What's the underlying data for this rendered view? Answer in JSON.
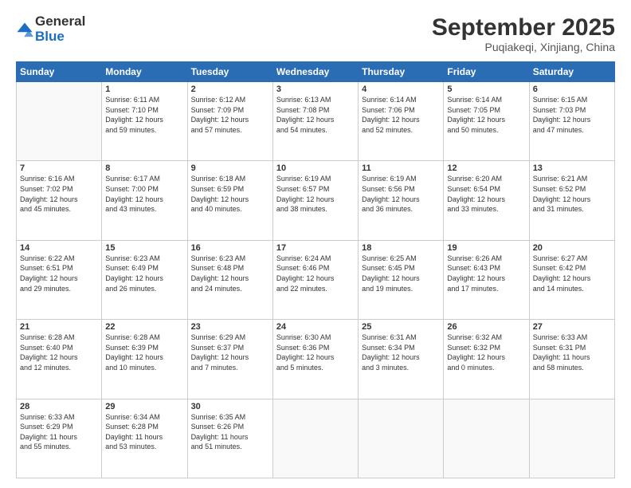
{
  "logo": {
    "general": "General",
    "blue": "Blue"
  },
  "header": {
    "month": "September 2025",
    "location": "Puqiakeqi, Xinjiang, China"
  },
  "weekdays": [
    "Sunday",
    "Monday",
    "Tuesday",
    "Wednesday",
    "Thursday",
    "Friday",
    "Saturday"
  ],
  "weeks": [
    [
      {
        "day": "",
        "info": ""
      },
      {
        "day": "1",
        "info": "Sunrise: 6:11 AM\nSunset: 7:10 PM\nDaylight: 12 hours\nand 59 minutes."
      },
      {
        "day": "2",
        "info": "Sunrise: 6:12 AM\nSunset: 7:09 PM\nDaylight: 12 hours\nand 57 minutes."
      },
      {
        "day": "3",
        "info": "Sunrise: 6:13 AM\nSunset: 7:08 PM\nDaylight: 12 hours\nand 54 minutes."
      },
      {
        "day": "4",
        "info": "Sunrise: 6:14 AM\nSunset: 7:06 PM\nDaylight: 12 hours\nand 52 minutes."
      },
      {
        "day": "5",
        "info": "Sunrise: 6:14 AM\nSunset: 7:05 PM\nDaylight: 12 hours\nand 50 minutes."
      },
      {
        "day": "6",
        "info": "Sunrise: 6:15 AM\nSunset: 7:03 PM\nDaylight: 12 hours\nand 47 minutes."
      }
    ],
    [
      {
        "day": "7",
        "info": "Sunrise: 6:16 AM\nSunset: 7:02 PM\nDaylight: 12 hours\nand 45 minutes."
      },
      {
        "day": "8",
        "info": "Sunrise: 6:17 AM\nSunset: 7:00 PM\nDaylight: 12 hours\nand 43 minutes."
      },
      {
        "day": "9",
        "info": "Sunrise: 6:18 AM\nSunset: 6:59 PM\nDaylight: 12 hours\nand 40 minutes."
      },
      {
        "day": "10",
        "info": "Sunrise: 6:19 AM\nSunset: 6:57 PM\nDaylight: 12 hours\nand 38 minutes."
      },
      {
        "day": "11",
        "info": "Sunrise: 6:19 AM\nSunset: 6:56 PM\nDaylight: 12 hours\nand 36 minutes."
      },
      {
        "day": "12",
        "info": "Sunrise: 6:20 AM\nSunset: 6:54 PM\nDaylight: 12 hours\nand 33 minutes."
      },
      {
        "day": "13",
        "info": "Sunrise: 6:21 AM\nSunset: 6:52 PM\nDaylight: 12 hours\nand 31 minutes."
      }
    ],
    [
      {
        "day": "14",
        "info": "Sunrise: 6:22 AM\nSunset: 6:51 PM\nDaylight: 12 hours\nand 29 minutes."
      },
      {
        "day": "15",
        "info": "Sunrise: 6:23 AM\nSunset: 6:49 PM\nDaylight: 12 hours\nand 26 minutes."
      },
      {
        "day": "16",
        "info": "Sunrise: 6:23 AM\nSunset: 6:48 PM\nDaylight: 12 hours\nand 24 minutes."
      },
      {
        "day": "17",
        "info": "Sunrise: 6:24 AM\nSunset: 6:46 PM\nDaylight: 12 hours\nand 22 minutes."
      },
      {
        "day": "18",
        "info": "Sunrise: 6:25 AM\nSunset: 6:45 PM\nDaylight: 12 hours\nand 19 minutes."
      },
      {
        "day": "19",
        "info": "Sunrise: 6:26 AM\nSunset: 6:43 PM\nDaylight: 12 hours\nand 17 minutes."
      },
      {
        "day": "20",
        "info": "Sunrise: 6:27 AM\nSunset: 6:42 PM\nDaylight: 12 hours\nand 14 minutes."
      }
    ],
    [
      {
        "day": "21",
        "info": "Sunrise: 6:28 AM\nSunset: 6:40 PM\nDaylight: 12 hours\nand 12 minutes."
      },
      {
        "day": "22",
        "info": "Sunrise: 6:28 AM\nSunset: 6:39 PM\nDaylight: 12 hours\nand 10 minutes."
      },
      {
        "day": "23",
        "info": "Sunrise: 6:29 AM\nSunset: 6:37 PM\nDaylight: 12 hours\nand 7 minutes."
      },
      {
        "day": "24",
        "info": "Sunrise: 6:30 AM\nSunset: 6:36 PM\nDaylight: 12 hours\nand 5 minutes."
      },
      {
        "day": "25",
        "info": "Sunrise: 6:31 AM\nSunset: 6:34 PM\nDaylight: 12 hours\nand 3 minutes."
      },
      {
        "day": "26",
        "info": "Sunrise: 6:32 AM\nSunset: 6:32 PM\nDaylight: 12 hours\nand 0 minutes."
      },
      {
        "day": "27",
        "info": "Sunrise: 6:33 AM\nSunset: 6:31 PM\nDaylight: 11 hours\nand 58 minutes."
      }
    ],
    [
      {
        "day": "28",
        "info": "Sunrise: 6:33 AM\nSunset: 6:29 PM\nDaylight: 11 hours\nand 55 minutes."
      },
      {
        "day": "29",
        "info": "Sunrise: 6:34 AM\nSunset: 6:28 PM\nDaylight: 11 hours\nand 53 minutes."
      },
      {
        "day": "30",
        "info": "Sunrise: 6:35 AM\nSunset: 6:26 PM\nDaylight: 11 hours\nand 51 minutes."
      },
      {
        "day": "",
        "info": ""
      },
      {
        "day": "",
        "info": ""
      },
      {
        "day": "",
        "info": ""
      },
      {
        "day": "",
        "info": ""
      }
    ]
  ]
}
